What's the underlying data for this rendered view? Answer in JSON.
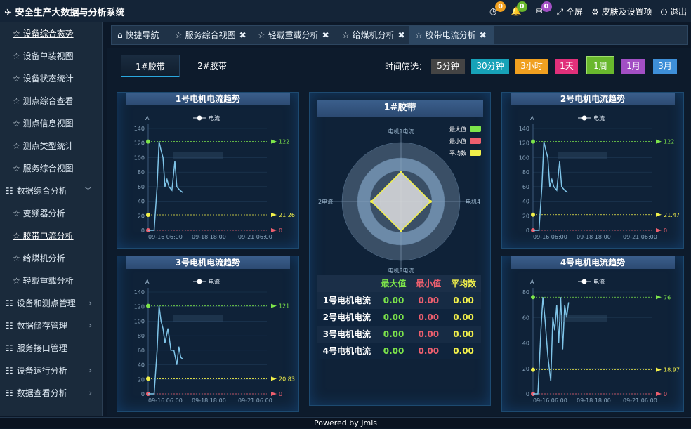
{
  "app": {
    "title": "安全生产大数据与分析系统",
    "badges": [
      "0",
      "0",
      "0"
    ],
    "fullscreen": "全屏",
    "skin": "皮肤及设置项",
    "logout": "退出",
    "footer": "Powered by Jmis"
  },
  "sidebar": {
    "items": [
      {
        "label": "设备综合态势",
        "type": "sub",
        "active": true
      },
      {
        "label": "设备单装视图",
        "type": "sub"
      },
      {
        "label": "设备状态统计",
        "type": "sub"
      },
      {
        "label": "测点综合查看",
        "type": "sub"
      },
      {
        "label": "测点信息视图",
        "type": "sub"
      },
      {
        "label": "测点类型统计",
        "type": "sub"
      },
      {
        "label": "服务综合视图",
        "type": "sub"
      },
      {
        "label": "数据综合分析",
        "type": "grp",
        "chev": "﹀"
      },
      {
        "label": "变频器分析",
        "type": "sub"
      },
      {
        "label": "胶带电流分析",
        "type": "sub",
        "active": true
      },
      {
        "label": "给煤机分析",
        "type": "sub"
      },
      {
        "label": "轻载重载分析",
        "type": "sub"
      },
      {
        "label": "设备和测点管理",
        "type": "grp",
        "chev": "›"
      },
      {
        "label": "数据储存管理",
        "type": "grp",
        "chev": "›"
      },
      {
        "label": "服务接口管理",
        "type": "grp"
      },
      {
        "label": "设备运行分析",
        "type": "grp",
        "chev": "›"
      },
      {
        "label": "数据查看分析",
        "type": "grp",
        "chev": "›"
      }
    ]
  },
  "tabs": [
    {
      "label": "快捷导航",
      "icon": "home-icon",
      "closable": false
    },
    {
      "label": "服务综合视图",
      "icon": "star-icon",
      "closable": true
    },
    {
      "label": "轻载重载分析",
      "icon": "star-icon",
      "closable": true
    },
    {
      "label": "给煤机分析",
      "icon": "star-icon",
      "closable": true
    },
    {
      "label": "胶带电流分析",
      "icon": "star-icon",
      "closable": true,
      "active": true
    }
  ],
  "belts": [
    "1#胶带",
    "2#胶带"
  ],
  "time_filter": {
    "label": "时间筛选：",
    "options": [
      {
        "label": "5分钟",
        "color": "#444444"
      },
      {
        "label": "30分钟",
        "color": "#17a2b8"
      },
      {
        "label": "3小时",
        "color": "#f0a020"
      },
      {
        "label": "1天",
        "color": "#e0307a"
      },
      {
        "label": "1周",
        "color": "#69b82d"
      },
      {
        "label": "1月",
        "color": "#a24fc4"
      },
      {
        "label": "3月",
        "color": "#3e8fd8"
      }
    ],
    "selected": "1周"
  },
  "colors": {
    "max": "#7de44a",
    "min": "#ee5f6e",
    "avg": "#f2f04a",
    "line": "#7fc4e8"
  },
  "center": {
    "title": "1#胶带",
    "labels": {
      "top": "电机1电流",
      "left": "2电流",
      "right": "电机4",
      "bottom": "电机3电流"
    },
    "legend": [
      "最大值",
      "最小值",
      "平均数"
    ]
  },
  "stats": {
    "headers": [
      "",
      "最大值",
      "最小值",
      "平均数"
    ],
    "rows": [
      [
        "1号电机电流",
        "0.00",
        "0.00",
        "0.00"
      ],
      [
        "2号电机电流",
        "0.00",
        "0.00",
        "0.00"
      ],
      [
        "3号电机电流",
        "0.00",
        "0.00",
        "0.00"
      ],
      [
        "4号电机电流",
        "0.00",
        "0.00",
        "0.00"
      ]
    ]
  },
  "chart_data": [
    {
      "type": "line",
      "title": "1号电机电流趋势",
      "ylabel": "A",
      "legend": "电流",
      "ylim": [
        0,
        140
      ],
      "yticks": [
        0,
        20,
        40,
        60,
        80,
        100,
        120,
        140
      ],
      "xticks": [
        "09-16 06:00",
        "09-18 18:00",
        "09-21 06:00"
      ],
      "markers": {
        "max": "122",
        "avg": "21.26",
        "min": "0"
      },
      "series": [
        {
          "name": "电流",
          "x": [
            0,
            0.6,
            0.9,
            1.1,
            1.3,
            1.5,
            1.7,
            1.9,
            2.1,
            2.4,
            2.7,
            2.9,
            3.2,
            3.5
          ],
          "y": [
            0,
            0,
            60,
            122,
            110,
            100,
            60,
            70,
            60,
            55,
            95,
            60,
            55,
            52
          ]
        }
      ]
    },
    {
      "type": "line",
      "title": "2号电机电流趋势",
      "ylabel": "A",
      "legend": "电流",
      "ylim": [
        0,
        140
      ],
      "yticks": [
        0,
        20,
        40,
        60,
        80,
        100,
        120,
        140
      ],
      "xticks": [
        "09-16 06:00",
        "09-18 18:00",
        "09-21 06:00"
      ],
      "markers": {
        "max": "122",
        "avg": "21.47",
        "min": "0"
      },
      "series": [
        {
          "name": "电流",
          "x": [
            0,
            0.6,
            0.9,
            1.1,
            1.3,
            1.5,
            1.7,
            1.9,
            2.1,
            2.4,
            2.7,
            2.9,
            3.2,
            3.5
          ],
          "y": [
            0,
            0,
            60,
            122,
            110,
            100,
            60,
            70,
            60,
            55,
            95,
            60,
            55,
            52
          ]
        }
      ]
    },
    {
      "type": "line",
      "title": "3号电机电流趋势",
      "ylabel": "A",
      "legend": "电流",
      "ylim": [
        0,
        140
      ],
      "yticks": [
        0,
        20,
        40,
        60,
        80,
        100,
        120,
        140
      ],
      "xticks": [
        "09-16 06:00",
        "09-18 18:00",
        "09-21 06:00"
      ],
      "markers": {
        "max": "121",
        "avg": "20.83",
        "min": "0"
      },
      "series": [
        {
          "name": "电流",
          "x": [
            0,
            0.6,
            0.9,
            1.1,
            1.3,
            1.5,
            1.7,
            2.0,
            2.3,
            2.6,
            2.9,
            3.1,
            3.3,
            3.5
          ],
          "y": [
            0,
            0,
            60,
            121,
            100,
            90,
            70,
            90,
            60,
            60,
            40,
            65,
            50,
            48
          ]
        }
      ]
    },
    {
      "type": "line",
      "title": "4号电机电流趋势",
      "ylabel": "A",
      "legend": "电流",
      "ylim": [
        0,
        80
      ],
      "yticks": [
        0,
        20,
        40,
        60,
        80
      ],
      "xticks": [
        "09-16 06:00",
        "09-18 18:00",
        "09-21 06:00"
      ],
      "markers": {
        "max": "76",
        "avg": "18.97",
        "min": "0"
      },
      "series": [
        {
          "name": "电流",
          "x": [
            0,
            0.5,
            0.8,
            1.0,
            1.2,
            1.5,
            1.8,
            2.0,
            2.2,
            2.4,
            2.6,
            2.8,
            3.0,
            3.2,
            3.4,
            3.6
          ],
          "y": [
            0,
            0,
            50,
            76,
            60,
            30,
            10,
            60,
            50,
            70,
            40,
            76,
            35,
            70,
            60,
            72
          ]
        }
      ]
    }
  ]
}
